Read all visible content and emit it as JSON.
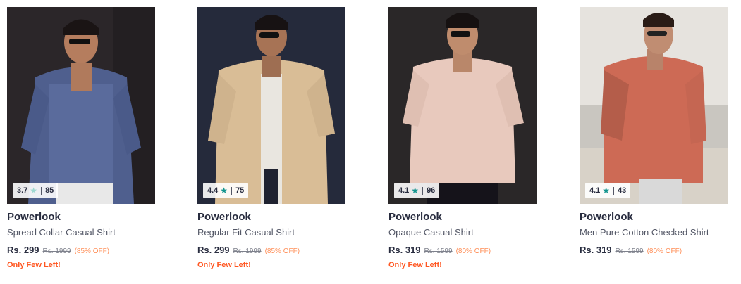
{
  "colors": {
    "star_gray": "#9fd8d2",
    "star_teal": "#14958f",
    "discount": "#ff905a",
    "few_left": "#ff5722"
  },
  "products": [
    {
      "brand": "Powerlook",
      "title": "Spread Collar Casual Shirt",
      "price": "Rs. 299",
      "mrp": "Rs. 1999",
      "discount": "(85% OFF)",
      "stock": "Only Few Left!",
      "rating": "3.7",
      "rating_count": "85",
      "star_icon": "star-icon",
      "image_alt": "man in blue textured shirt"
    },
    {
      "brand": "Powerlook",
      "title": "Regular Fit Casual Shirt",
      "price": "Rs. 299",
      "mrp": "Rs. 1999",
      "discount": "(85% OFF)",
      "stock": "Only Few Left!",
      "rating": "4.4",
      "rating_count": "75",
      "star_icon": "star-icon",
      "image_alt": "man in beige knit shirt"
    },
    {
      "brand": "Powerlook",
      "title": "Opaque Casual Shirt",
      "price": "Rs. 319",
      "mrp": "Rs. 1599",
      "discount": "(80% OFF)",
      "stock": "Only Few Left!",
      "rating": "4.1",
      "rating_count": "96",
      "star_icon": "star-icon",
      "image_alt": "man in pink knit shirt"
    },
    {
      "brand": "Powerlook",
      "title": "Men Pure Cotton Checked Shirt",
      "price": "Rs. 319",
      "mrp": "Rs. 1599",
      "discount": "(80% OFF)",
      "stock": "",
      "rating": "4.1",
      "rating_count": "43",
      "star_icon": "star-icon",
      "image_alt": "man in rust checked shirt at beach"
    }
  ]
}
